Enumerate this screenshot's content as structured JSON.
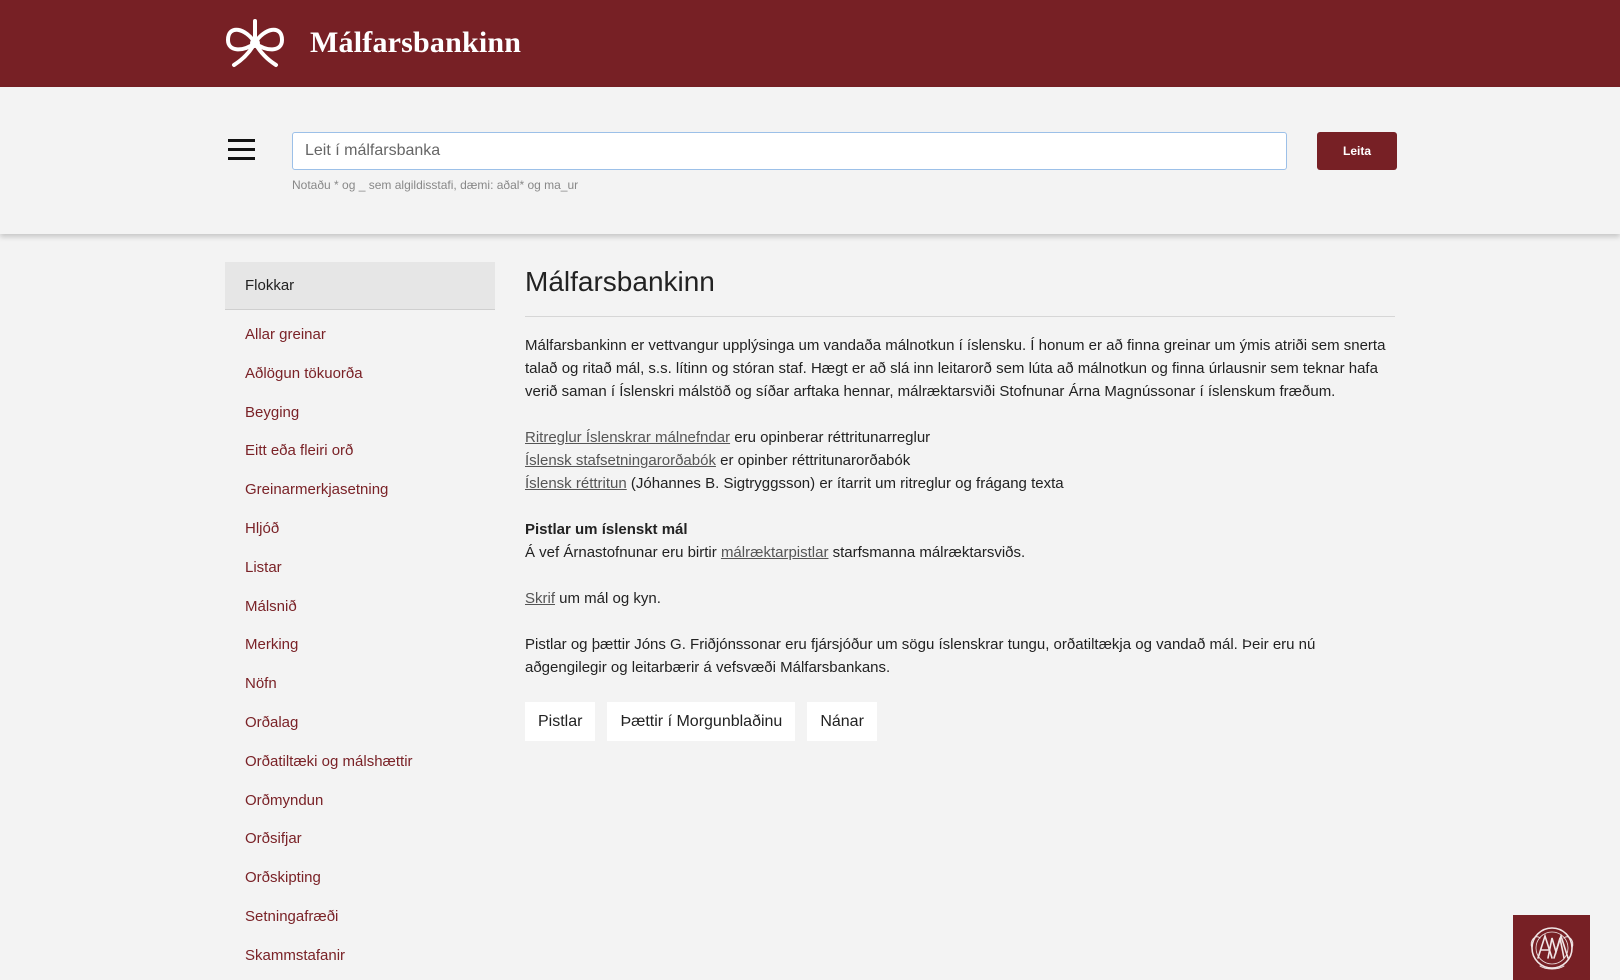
{
  "header": {
    "brand_name": "Málfarsbankinn",
    "logo_icon": "bow-icon",
    "brand_color": "#772025"
  },
  "search": {
    "menu_icon": "hamburger-menu-icon",
    "placeholder": "Leit í málfarsbanka",
    "value": "",
    "hint": "Notaðu * og _ sem algildisstafi, dæmi: aðal* og ma_ur",
    "button_label": "Leita"
  },
  "sidebar": {
    "header": "Flokkar",
    "items": [
      {
        "label": "Allar greinar"
      },
      {
        "label": "Aðlögun tökuorða"
      },
      {
        "label": "Beyging"
      },
      {
        "label": "Eitt eða fleiri orð"
      },
      {
        "label": "Greinarmerkjasetning"
      },
      {
        "label": "Hljóð"
      },
      {
        "label": "Listar"
      },
      {
        "label": "Málsnið"
      },
      {
        "label": "Merking"
      },
      {
        "label": "Nöfn"
      },
      {
        "label": "Orðalag"
      },
      {
        "label": "Orðatiltæki og málshættir"
      },
      {
        "label": "Orðmyndun"
      },
      {
        "label": "Orðsifjar"
      },
      {
        "label": "Orðskipting"
      },
      {
        "label": "Setningafræði"
      },
      {
        "label": "Skammstafanir"
      }
    ]
  },
  "main": {
    "title": "Málfarsbankinn",
    "intro": "Málfarsbankinn er vettvangur upplýsinga um vandaða málnotkun í íslensku. Í honum er að finna greinar um ýmis atriði sem snerta talað og ritað mál, s.s. lítinn og stóran staf. Hægt er að slá inn leitarorð sem lúta að málnotkun og finna úrlausnir sem teknar hafa verið saman í Íslenskri málstöð og síðar arftaka hennar, málræktarsviði Stofnunar Árna Magnússonar í íslenskum fræðum.",
    "links": [
      {
        "link_text": "Ritreglur Íslenskrar málnefndar",
        "rest": " eru opinberar réttritunarreglur"
      },
      {
        "link_text": "Íslensk stafsetningarorðabók",
        "rest": " er opinber réttritunarorðabók"
      },
      {
        "link_text": "Íslensk réttritun",
        "rest": " (Jóhannes B. Sigtryggsson) er ítarrit um ritreglur og frágang texta"
      }
    ],
    "pistlar_heading": "Pistlar um íslenskt mál",
    "pistlar_before": "Á vef Árnastofnunar eru birtir ",
    "pistlar_link": "málræktarpistlar",
    "pistlar_after": " starfsmanna málræktarsviðs.",
    "skrif_link": "Skrif",
    "skrif_after": " um mál og kyn.",
    "jon_para": "Pistlar og þættir Jóns G. Friðjónssonar eru fjársjóður um sögu íslenskrar tungu, orðatiltækja og vandað mál. Þeir eru nú aðgengilegir og leitarbærir á vefsvæði Málfarsbankans.",
    "buttons": [
      {
        "label": "Pistlar"
      },
      {
        "label": "Þættir í Morgunblaðinu"
      },
      {
        "label": "Nánar"
      }
    ]
  },
  "footer": {
    "badge_icon": "ama-monogram-icon"
  }
}
